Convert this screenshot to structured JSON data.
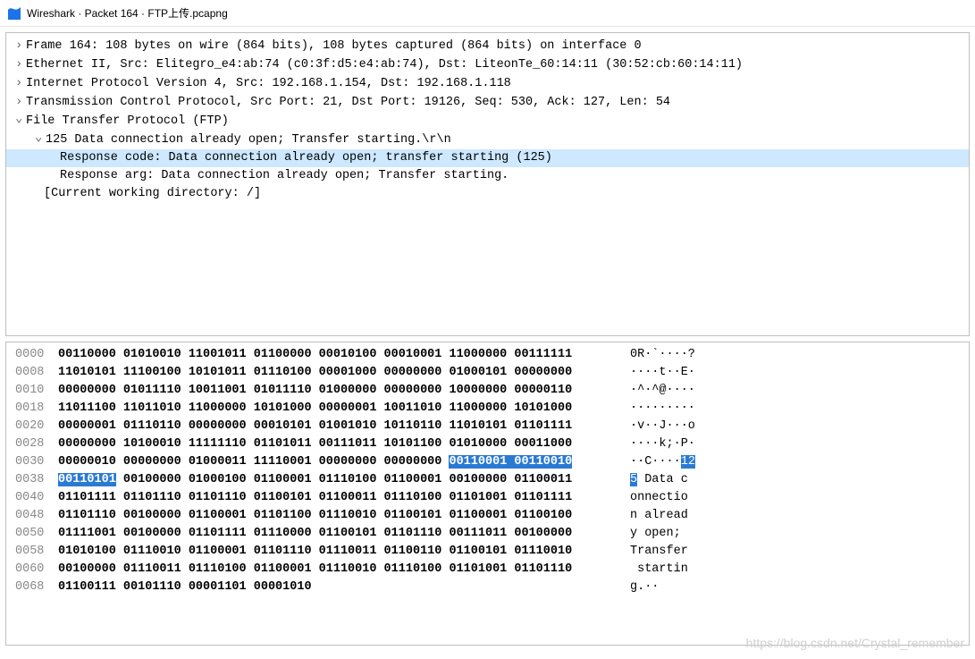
{
  "titlebar": {
    "text": "Wireshark · Packet 164 · FTP上传.pcapng"
  },
  "tree": {
    "r1": "Frame 164: 108 bytes on wire (864 bits), 108 bytes captured (864 bits) on interface 0",
    "r2": "Ethernet II, Src: Elitegro_e4:ab:74 (c0:3f:d5:e4:ab:74), Dst: LiteonTe_60:14:11 (30:52:cb:60:14:11)",
    "r3": "Internet Protocol Version 4, Src: 192.168.1.154, Dst: 192.168.1.118",
    "r4": "Transmission Control Protocol, Src Port: 21, Dst Port: 19126, Seq: 530, Ack: 127, Len: 54",
    "r5": "File Transfer Protocol (FTP)",
    "r6": "125 Data connection already open; Transfer starting.\\r\\n",
    "r7": "Response code: Data connection already open; transfer starting (125)",
    "r8": "Response arg: Data connection already open; Transfer starting.",
    "r9": "[Current working directory: /]"
  },
  "hex": {
    "rows": [
      {
        "off": "0000",
        "pre": "00110000 01010010 11001011 01100000 00010100 00010001 11000000 00111111",
        "hl": "",
        "post": "",
        "pa": "0R·`····?",
        "ha": "",
        "aa": ""
      },
      {
        "off": "0008",
        "pre": "11010101 11100100 10101011 01110100 00001000 00000000 01000101 00000000",
        "hl": "",
        "post": "",
        "pa": "····t··E·",
        "ha": "",
        "aa": ""
      },
      {
        "off": "0010",
        "pre": "00000000 01011110 10011001 01011110 01000000 00000000 10000000 00000110",
        "hl": "",
        "post": "",
        "pa": "·^·^@····",
        "ha": "",
        "aa": ""
      },
      {
        "off": "0018",
        "pre": "11011100 11011010 11000000 10101000 00000001 10011010 11000000 10101000",
        "hl": "",
        "post": "",
        "pa": "·········",
        "ha": "",
        "aa": ""
      },
      {
        "off": "0020",
        "pre": "00000001 01110110 00000000 00010101 01001010 10110110 11010101 01101111",
        "hl": "",
        "post": "",
        "pa": "·v··J···o",
        "ha": "",
        "aa": ""
      },
      {
        "off": "0028",
        "pre": "00000000 10100010 11111110 01101011 00111011 10101100 01010000 00011000",
        "hl": "",
        "post": "",
        "pa": "····k;·P·",
        "ha": "",
        "aa": ""
      },
      {
        "off": "0030",
        "pre": "00000010 00000000 01000011 11110001 00000000 00000000 ",
        "hl": "00110001 00110010",
        "post": "",
        "pa": "··C····",
        "ha": "12",
        "aa": ""
      },
      {
        "off": "0038",
        "pre": "",
        "hl": "00110101",
        "post": " 00100000 01000100 01100001 01110100 01100001 00100000 01100011",
        "pa": "",
        "ha": "5",
        "aa": " Data c"
      },
      {
        "off": "0040",
        "pre": "01101111 01101110 01101110 01100101 01100011 01110100 01101001 01101111",
        "hl": "",
        "post": "",
        "pa": "onnectio",
        "ha": "",
        "aa": ""
      },
      {
        "off": "0048",
        "pre": "01101110 00100000 01100001 01101100 01110010 01100101 01100001 01100100",
        "hl": "",
        "post": "",
        "pa": "n alread",
        "ha": "",
        "aa": ""
      },
      {
        "off": "0050",
        "pre": "01111001 00100000 01101111 01110000 01100101 01101110 00111011 00100000",
        "hl": "",
        "post": "",
        "pa": "y open; ",
        "ha": "",
        "aa": ""
      },
      {
        "off": "0058",
        "pre": "01010100 01110010 01100001 01101110 01110011 01100110 01100101 01110010",
        "hl": "",
        "post": "",
        "pa": "Transfer",
        "ha": "",
        "aa": ""
      },
      {
        "off": "0060",
        "pre": "00100000 01110011 01110100 01100001 01110010 01110100 01101001 01101110",
        "hl": "",
        "post": "",
        "pa": " startin",
        "ha": "",
        "aa": ""
      },
      {
        "off": "0068",
        "pre": "01100111 00101110 00001101 00001010",
        "hl": "",
        "post": "",
        "pa": "g.··",
        "ha": "",
        "aa": ""
      }
    ]
  },
  "watermark": "https://blog.csdn.net/Crystal_remember"
}
